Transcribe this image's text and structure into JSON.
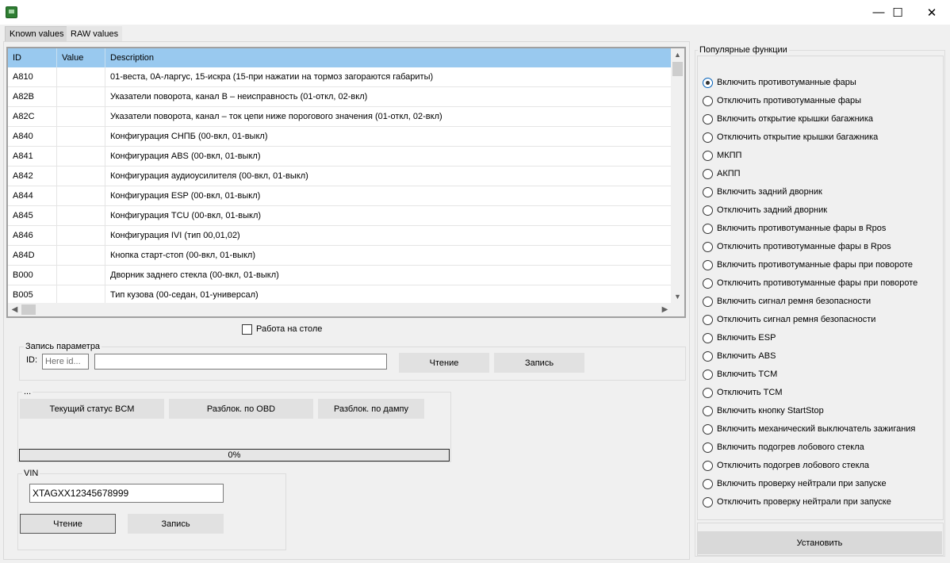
{
  "window": {
    "minimize": "—",
    "maximize": "☐",
    "close": "✕"
  },
  "tabs": [
    {
      "label": "Known values",
      "active": true
    },
    {
      "label": "RAW values",
      "active": false
    }
  ],
  "grid": {
    "headers": [
      "ID",
      "Value",
      "Description"
    ],
    "rows": [
      {
        "id": "A810",
        "value": "",
        "desc": "01-веста, 0А-ларгус, 15-искра (15-при нажатии на тормоз загораются габариты)"
      },
      {
        "id": "A82B",
        "value": "",
        "desc": "Указатели поворота, канал В – неисправность (01-откл, 02-вкл)"
      },
      {
        "id": "A82C",
        "value": "",
        "desc": "Указатели поворота, канал  – ток цепи ниже порогового значения (01-откл, 02-вкл)"
      },
      {
        "id": "A840",
        "value": "",
        "desc": "Конфигурация СНПБ (00-вкл, 01-выкл)"
      },
      {
        "id": "A841",
        "value": "",
        "desc": "Конфигурация ABS (00-вкл, 01-выкл)"
      },
      {
        "id": "A842",
        "value": "",
        "desc": "Конфигурация аудиоусилителя (00-вкл, 01-выкл)"
      },
      {
        "id": "A844",
        "value": "",
        "desc": "Конфигурация ESP (00-вкл, 01-выкл)"
      },
      {
        "id": "A845",
        "value": "",
        "desc": "Конфигурация TCU (00-вкл, 01-выкл)"
      },
      {
        "id": "A846",
        "value": "",
        "desc": "Конфигурация IVI (тип 00,01,02)"
      },
      {
        "id": "A84D",
        "value": "",
        "desc": "Кнопка старт-стоп (00-вкл, 01-выкл)"
      },
      {
        "id": "B000",
        "value": "",
        "desc": "Дворник заднего стекла (00-вкл, 01-выкл)"
      },
      {
        "id": "B005",
        "value": "",
        "desc": "Тип кузова (00-седан, 01-универсал)"
      }
    ]
  },
  "work_on_table": {
    "label": "Работа на столе",
    "checked": false
  },
  "param_write": {
    "legend": "Запись параметра",
    "id_label": "ID:",
    "id_placeholder": "Here id...",
    "value": "",
    "read_label": "Чтение",
    "write_label": "Запись"
  },
  "bcm": {
    "legend": "...",
    "status_label": "Текущий статус BCM",
    "unlock_obd_label": "Разблок. по OBD",
    "unlock_dump_label": "Разблок. по дампу",
    "progress_text": "0%",
    "progress_value": 0
  },
  "vin": {
    "legend": "VIN",
    "value": "XTAGXX12345678999",
    "read_label": "Чтение",
    "write_label": "Запись"
  },
  "functions": {
    "legend": "Популярные функции",
    "selected_index": 0,
    "items": [
      "Включить противотуманные фары",
      "Отключить противотуманные фары",
      "Включить открытие крышки багажника",
      "Отключить открытие крышки багажника",
      "МКПП",
      "АКПП",
      "Включить задний дворник",
      "Отключить задний дворник",
      "Включить противотуманные фары в Rpos",
      "Отключить противотуманные фары в Rpos",
      "Включить противотуманные фары при повороте",
      "Отключить противотуманные фары при повороте",
      "Включить сигнал ремня безопасности",
      "Отключить сигнал ремня безопасности",
      "Включить ESP",
      "Включить ABS",
      "Включить TCM",
      "Отключить TCM",
      "Включить кнопку StartStop",
      "Включить механический выключатель зажигания",
      "Включить подогрев лобового стекла",
      "Отключить подогрев лобового стекла",
      "Включить проверку нейтрали при запуске",
      "Отключить проверку нейтрали при запуске"
    ],
    "install_label": "Установить"
  }
}
